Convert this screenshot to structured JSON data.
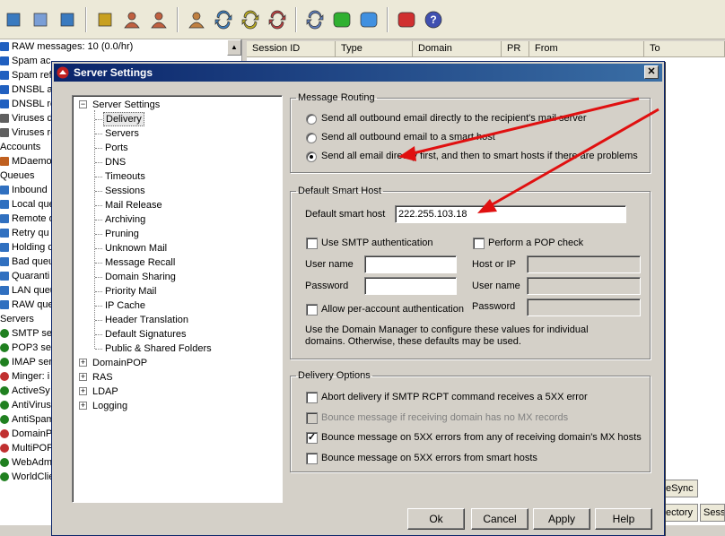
{
  "toolbar": {
    "icons": [
      "connect-icon",
      "filter-icon",
      "find-icon",
      "lock-icon",
      "users-search-icon",
      "user-icon",
      "users-icon",
      "queue-refresh-icon",
      "queue-refresh-yellow-icon",
      "queue-refresh-red-icon",
      "queue-refresh-blue-icon",
      "green-status-icon",
      "blue-status-icon",
      "red-status-icon",
      "help-icon"
    ]
  },
  "bg_tree": {
    "items": [
      {
        "label": "RAW messages: 10  (0.0/hr)",
        "icon": "status-icon",
        "color": "#2060c0"
      },
      {
        "label": "Spam ac",
        "icon": "status-icon",
        "color": "#2060c0"
      },
      {
        "label": "Spam ref",
        "icon": "status-icon",
        "color": "#2060c0"
      },
      {
        "label": "DNSBL ac",
        "icon": "status-icon",
        "color": "#2060c0"
      },
      {
        "label": "DNSBL re",
        "icon": "status-icon",
        "color": "#2060c0"
      },
      {
        "label": "Viruses d",
        "icon": "virus-icon",
        "color": "#606060"
      },
      {
        "label": "Viruses re",
        "icon": "virus-icon",
        "color": "#606060"
      },
      {
        "label": "Accounts",
        "icon": "",
        "color": ""
      },
      {
        "label": "MDaemor",
        "icon": "user-icon",
        "color": "#c06020"
      },
      {
        "label": "Queues",
        "icon": "",
        "color": ""
      },
      {
        "label": "Inbound",
        "icon": "queue-icon",
        "color": "#3070c0"
      },
      {
        "label": "Local que",
        "icon": "queue-icon",
        "color": "#3070c0"
      },
      {
        "label": "Remote q",
        "icon": "queue-icon",
        "color": "#3070c0"
      },
      {
        "label": "Retry qu",
        "icon": "queue-icon",
        "color": "#3070c0"
      },
      {
        "label": "Holding q",
        "icon": "queue-icon",
        "color": "#3070c0"
      },
      {
        "label": "Bad queu",
        "icon": "queue-icon",
        "color": "#3070c0"
      },
      {
        "label": "Quaranti",
        "icon": "queue-icon",
        "color": "#3070c0"
      },
      {
        "label": "LAN queu",
        "icon": "queue-icon",
        "color": "#3070c0"
      },
      {
        "label": "RAW que",
        "icon": "queue-icon",
        "color": "#3070c0"
      },
      {
        "label": "Servers",
        "icon": "",
        "color": ""
      },
      {
        "label": "SMTP ser",
        "icon": "server-icon",
        "color": "#208020"
      },
      {
        "label": "POP3 ser",
        "icon": "server-icon",
        "color": "#208020"
      },
      {
        "label": "IMAP ser",
        "icon": "server-icon",
        "color": "#208020"
      },
      {
        "label": "Minger: i",
        "icon": "server-icon",
        "color": "#c03030"
      },
      {
        "label": "ActiveSy",
        "icon": "server-icon",
        "color": "#208020"
      },
      {
        "label": "AntiVirus",
        "icon": "server-icon",
        "color": "#208020"
      },
      {
        "label": "AntiSpam",
        "icon": "server-icon",
        "color": "#208020"
      },
      {
        "label": "DomainP",
        "icon": "server-icon",
        "color": "#c03030"
      },
      {
        "label": "MultiPOP",
        "icon": "server-icon",
        "color": "#c03030"
      },
      {
        "label": "WebAdm",
        "icon": "server-icon",
        "color": "#208020"
      },
      {
        "label": "WorldClie",
        "icon": "server-icon",
        "color": "#208020"
      }
    ]
  },
  "grid": {
    "columns": [
      "Session ID",
      "Type",
      "Domain",
      "PR",
      "From",
      "To"
    ]
  },
  "bg_tabs": {
    "activesync": "eSync",
    "directory": "ectory",
    "session": "Sess"
  },
  "dialog": {
    "title": "Server Settings",
    "close_glyph": "✕",
    "tree": {
      "root": "Server Settings",
      "children": [
        "Delivery",
        "Servers",
        "Ports",
        "DNS",
        "Timeouts",
        "Sessions",
        "Mail Release",
        "Archiving",
        "Pruning",
        "Unknown Mail",
        "Message Recall",
        "Domain Sharing",
        "Priority Mail",
        "IP Cache",
        "Header Translation",
        "Default Signatures",
        "Public & Shared Folders"
      ],
      "selected": "Delivery",
      "collapsed": [
        "DomainPOP",
        "RAS",
        "LDAP",
        "Logging"
      ]
    },
    "routing": {
      "legend": "Message Routing",
      "options": [
        "Send all outbound email directly to the recipient's mail server",
        "Send all outbound email to a smart host",
        "Send all email directly first, and then to smart hosts if there are problems"
      ],
      "selected_index": 2
    },
    "smarthost": {
      "legend": "Default Smart Host",
      "host_label": "Default smart host",
      "host_value": "222.255.103.18",
      "smtp_auth_label": "Use SMTP authentication",
      "pop_check_label": "Perform a POP check",
      "user_label": "User name",
      "pass_label": "Password",
      "hostip_label": "Host or IP",
      "pop_user_label": "User name",
      "pop_pass_label": "Password",
      "per_account_label": "Allow per-account authentication",
      "note": "Use the Domain Manager to configure these values for individual domains. Otherwise, these defaults may be used."
    },
    "delivery": {
      "legend": "Delivery Options",
      "options": [
        {
          "label": "Abort delivery if SMTP RCPT command receives a  5XX error",
          "checked": false,
          "disabled": false
        },
        {
          "label": "Bounce message if receiving domain has no MX records",
          "checked": false,
          "disabled": true
        },
        {
          "label": "Bounce message on 5XX errors from any of receiving domain's MX hosts",
          "checked": true,
          "disabled": false
        },
        {
          "label": "Bounce message on 5XX errors from smart hosts",
          "checked": false,
          "disabled": false
        }
      ]
    },
    "buttons": {
      "ok": "Ok",
      "cancel": "Cancel",
      "apply": "Apply",
      "help": "Help"
    }
  },
  "annotation_color": "#e01010"
}
